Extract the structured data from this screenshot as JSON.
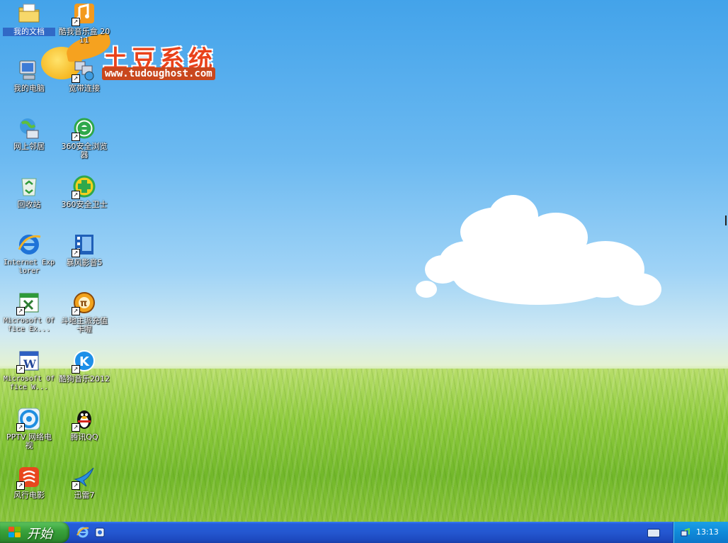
{
  "logo": {
    "title": "土豆系统",
    "url": "www.tudoughost.com"
  },
  "icons": [
    {
      "label": "我的文档",
      "name": "my-documents",
      "shortcut": false,
      "selected": true
    },
    {
      "label": "酷我音乐盒 2011",
      "name": "kuwo-music",
      "shortcut": true
    },
    {
      "label": "我的电脑",
      "name": "my-computer",
      "shortcut": false
    },
    {
      "label": "宽带连接",
      "name": "broadband-connection",
      "shortcut": true
    },
    {
      "label": "网上邻居",
      "name": "network-places",
      "shortcut": false
    },
    {
      "label": "360安全浏览器",
      "name": "360-browser",
      "shortcut": true
    },
    {
      "label": "回收站",
      "name": "recycle-bin",
      "shortcut": false
    },
    {
      "label": "360安全卫士",
      "name": "360-safeguard",
      "shortcut": true
    },
    {
      "label": "Internet Explorer",
      "name": "internet-explorer",
      "shortcut": false
    },
    {
      "label": "暴风影音5",
      "name": "baofeng-player",
      "shortcut": true
    },
    {
      "label": "Microsoft Office Ex...",
      "name": "office-excel",
      "shortcut": true
    },
    {
      "label": "斗地主派充值卡喔",
      "name": "doudizhu-game",
      "shortcut": true
    },
    {
      "label": "Microsoft Office W...",
      "name": "office-word",
      "shortcut": true
    },
    {
      "label": "酷狗音乐2012",
      "name": "kugou-music",
      "shortcut": true
    },
    {
      "label": "PPTV 网络电视",
      "name": "pptv",
      "shortcut": true
    },
    {
      "label": "腾讯QQ",
      "name": "tencent-qq",
      "shortcut": true
    },
    {
      "label": "风行电影",
      "name": "funshion-movie",
      "shortcut": true
    },
    {
      "label": "迅雷7",
      "name": "xunlei-7",
      "shortcut": true
    }
  ],
  "taskbar": {
    "start_label": "开始",
    "quicklaunch": [
      "internet-explorer-icon",
      "show-desktop-icon"
    ],
    "clock": "13:13"
  },
  "colors": {
    "taskbar": "#245edb",
    "start": "#3aa33c",
    "tray": "#0f8ad9",
    "selection": "#3169c6"
  }
}
